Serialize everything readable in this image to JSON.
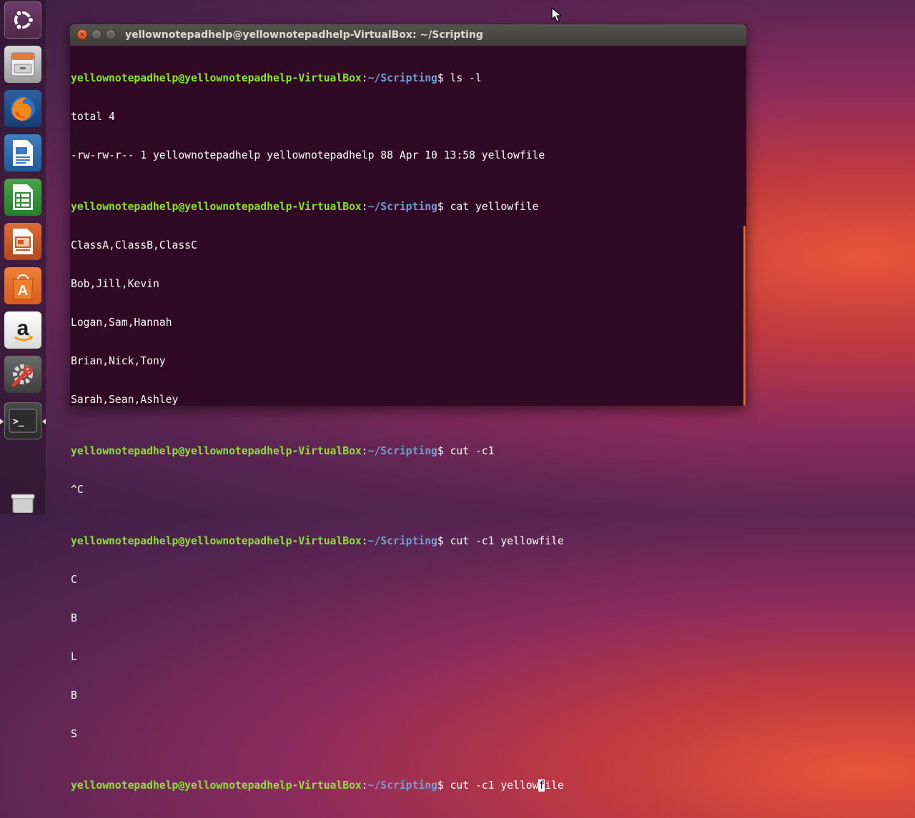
{
  "window": {
    "title": "yellownotepadhelp@yellownotepadhelp-VirtualBox: ~/Scripting",
    "close_glyph": "×",
    "min_glyph": "–",
    "max_glyph": "▫"
  },
  "prompt": {
    "user_host": "yellownotepadhelp@yellownotepadhelp-VirtualBox",
    "colon": ":",
    "dir": "~/Scripting",
    "dollar": "$ "
  },
  "terminal": {
    "cmd1": "ls -l",
    "out1": [
      "total 4",
      "-rw-rw-r-- 1 yellownotepadhelp yellownotepadhelp 88 Apr 10 13:58 yellowfile"
    ],
    "cmd2": "cat yellowfile",
    "out2": [
      "ClassA,ClassB,ClassC",
      "Bob,Jill,Kevin",
      "Logan,Sam,Hannah",
      "Brian,Nick,Tony",
      "Sarah,Sean,Ashley"
    ],
    "cmd3": "cut -c1",
    "out3": [
      "^C"
    ],
    "cmd4": "cut -c1 yellowfile",
    "out4": [
      "C",
      "B",
      "L",
      "B",
      "S"
    ],
    "cmd5_before_cursor": "cut -c1 yellow",
    "cmd5_cursor_char": "f",
    "cmd5_after_cursor": "ile"
  },
  "launcher": {
    "items": [
      {
        "name": "ubuntu-dash",
        "icon": "ubuntu-logo-icon"
      },
      {
        "name": "files",
        "icon": "file-cabinet-icon"
      },
      {
        "name": "firefox",
        "icon": "firefox-icon"
      },
      {
        "name": "libreoffice-writer",
        "icon": "writer-document-icon"
      },
      {
        "name": "libreoffice-calc",
        "icon": "calc-spreadsheet-icon"
      },
      {
        "name": "libreoffice-impress",
        "icon": "impress-presentation-icon"
      },
      {
        "name": "ubuntu-software",
        "icon": "shopping-bag-icon"
      },
      {
        "name": "amazon",
        "icon": "amazon-icon"
      },
      {
        "name": "system-settings",
        "icon": "settings-wrench-icon"
      },
      {
        "name": "terminal",
        "icon": "terminal-icon"
      },
      {
        "name": "trash",
        "icon": "trash-icon"
      }
    ],
    "amazon_glyph": "a",
    "store_glyph": "A",
    "terminal_glyph": ">_"
  },
  "colors": {
    "terminal_bg": "#300a24",
    "prompt_user": "#8ae234",
    "prompt_dir": "#729fcf",
    "accent": "#e86a2e"
  }
}
